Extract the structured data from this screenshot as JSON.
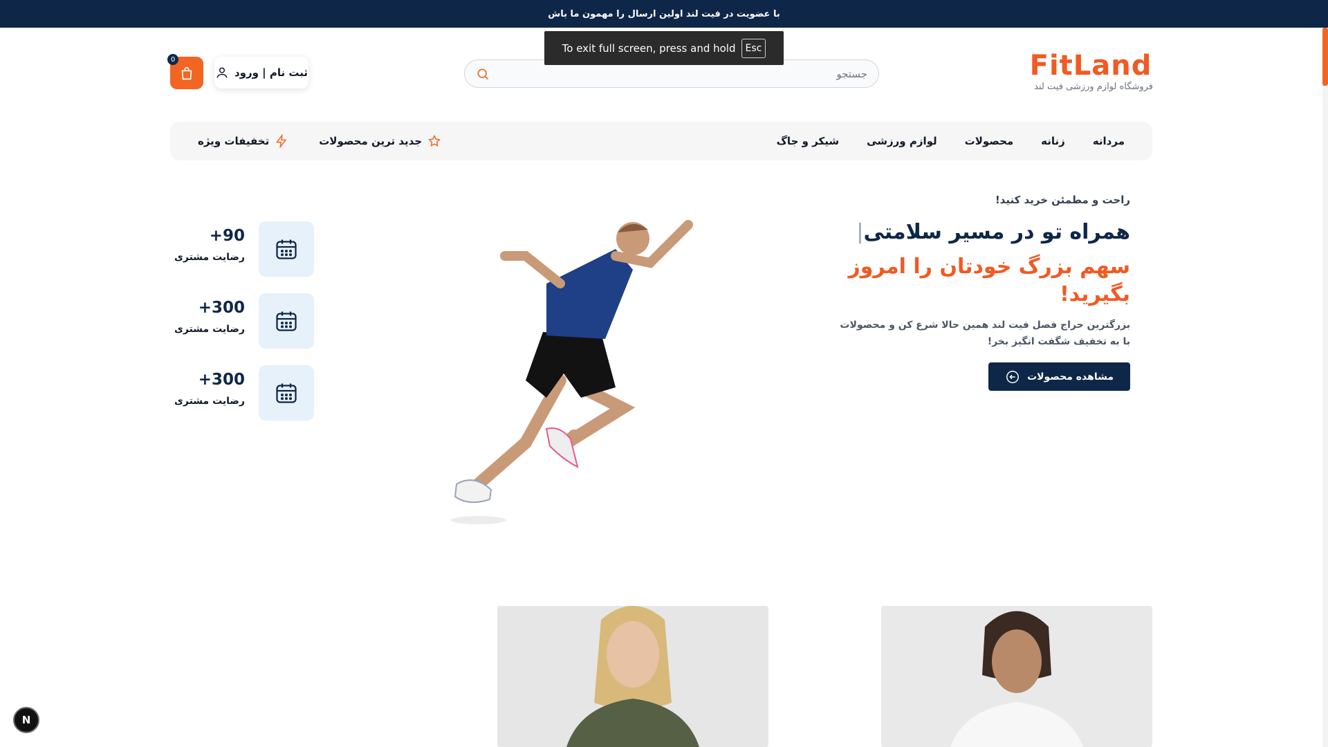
{
  "announcement": "با عضویت در فیت لند اولین ارسال را مهمون ما باش",
  "fullscreen_notice": {
    "text": "To exit full screen, press and hold",
    "key": "Esc"
  },
  "header": {
    "logo": "FitLand",
    "logo_subtitle": "فروشگاه لوازم ورزشی فیت لند",
    "search_placeholder": "جستجو",
    "login_label": "ثبت نام | ورود",
    "cart_count": "0"
  },
  "nav": {
    "items": [
      {
        "label": "مردانه"
      },
      {
        "label": "زنانه"
      },
      {
        "label": "محصولات"
      },
      {
        "label": "لوازم ورزشی"
      },
      {
        "label": "شیکر و جاگ"
      }
    ],
    "newest_label": "جدید ترین محصولات",
    "deals_label": "تخفیفات ویژه"
  },
  "hero": {
    "eyebrow": "راحت و مطمئن خرید کنید!",
    "title_line1": "همراه تو در مسیر سلامتی",
    "title_line2": "سهم بزرگ خودتان را امروز بگیرید!",
    "description": "بزرگترین حراج فصل فیت لند همین حالا شرع کن و محصولات با به تخفیف شگفت انگیز بخر!",
    "cta_label": "مشاهده محصولات"
  },
  "stats": [
    {
      "value": "+90",
      "label": "رضایت مشتری"
    },
    {
      "value": "+300",
      "label": "رضایت مشتری"
    },
    {
      "value": "+300",
      "label": "رضایت مشتری"
    }
  ],
  "floating_button": "N",
  "colors": {
    "primary": "#0e2748",
    "accent": "#f26522",
    "stat_bg": "#e6f1fa"
  },
  "icons": [
    "search-icon",
    "user-icon",
    "shopping-bag-icon",
    "star-icon",
    "lightning-icon",
    "calendar-icon",
    "arrow-left-circle-icon"
  ]
}
